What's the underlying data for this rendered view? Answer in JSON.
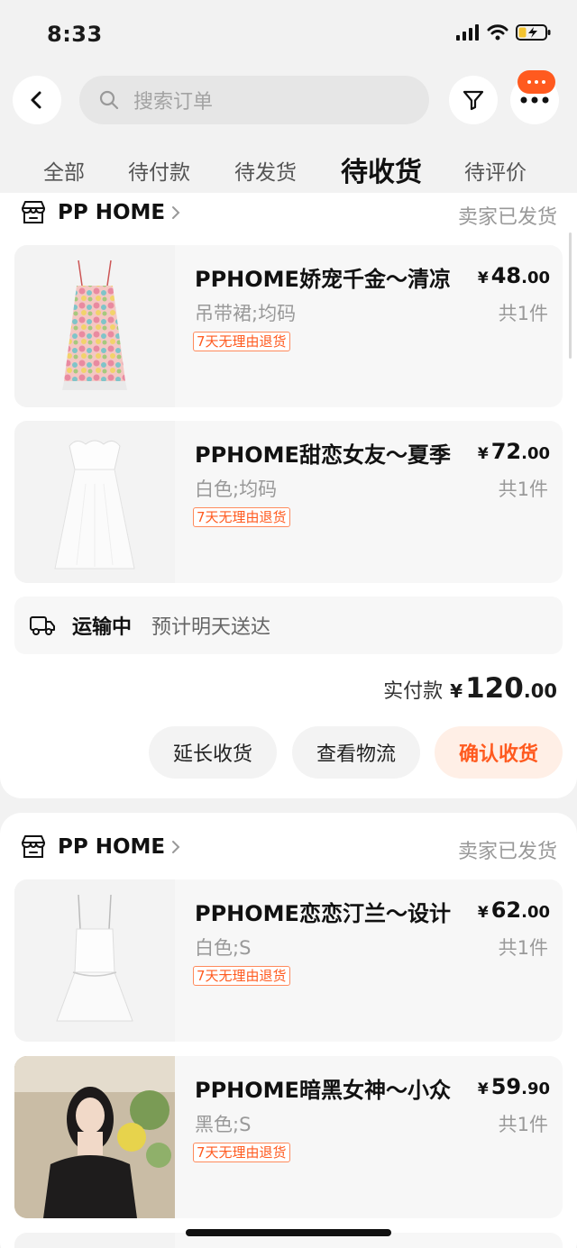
{
  "status_bar": {
    "time": "8:33"
  },
  "nav": {
    "search_placeholder": "搜索订单"
  },
  "tabs": [
    {
      "label": "全部",
      "active": false
    },
    {
      "label": "待付款",
      "active": false
    },
    {
      "label": "待发货",
      "active": false
    },
    {
      "label": "待收货",
      "active": true
    },
    {
      "label": "待评价",
      "active": false
    }
  ],
  "orders": [
    {
      "shop": "PP HOME",
      "status": "卖家已发货",
      "items": [
        {
          "title": "PPHOME娇宠千金～清凉",
          "spec": "吊带裙;均码",
          "tag": "7天无理由退货",
          "price_int": "48",
          "price_dec": ".00",
          "currency": "¥",
          "qty": "共1件"
        },
        {
          "title": "PPHOME甜恋女友～夏季",
          "spec": "白色;均码",
          "tag": "7天无理由退货",
          "price_int": "72",
          "price_dec": ".00",
          "currency": "¥",
          "qty": "共1件"
        }
      ],
      "logistics": {
        "status": "运输中",
        "eta": "预计明天送达"
      },
      "total": {
        "label": "实付款",
        "currency": "¥",
        "int": "120",
        "dec": ".00"
      },
      "actions": {
        "extend": "延长收货",
        "track": "查看物流",
        "confirm": "确认收货"
      }
    },
    {
      "shop": "PP HOME",
      "status": "卖家已发货",
      "items": [
        {
          "title": "PPHOME恋恋汀兰～设计",
          "spec": "白色;S",
          "tag": "7天无理由退货",
          "price_int": "62",
          "price_dec": ".00",
          "currency": "¥",
          "qty": "共1件"
        },
        {
          "title": "PPHOME暗黑女神～小众",
          "spec": "黑色;S",
          "tag": "7天无理由退货",
          "price_int": "59",
          "price_dec": ".90",
          "currency": "¥",
          "qty": "共1件"
        }
      ]
    }
  ],
  "colors": {
    "accent": "#ff5a1f",
    "background": "#f2f2f2",
    "muted_text": "#999999"
  },
  "icons": [
    "back-arrow-icon",
    "search-icon",
    "filter-icon",
    "more-icon",
    "shop-icon",
    "chevron-right-icon",
    "truck-icon",
    "signal-icon",
    "wifi-icon",
    "battery-icon"
  ]
}
